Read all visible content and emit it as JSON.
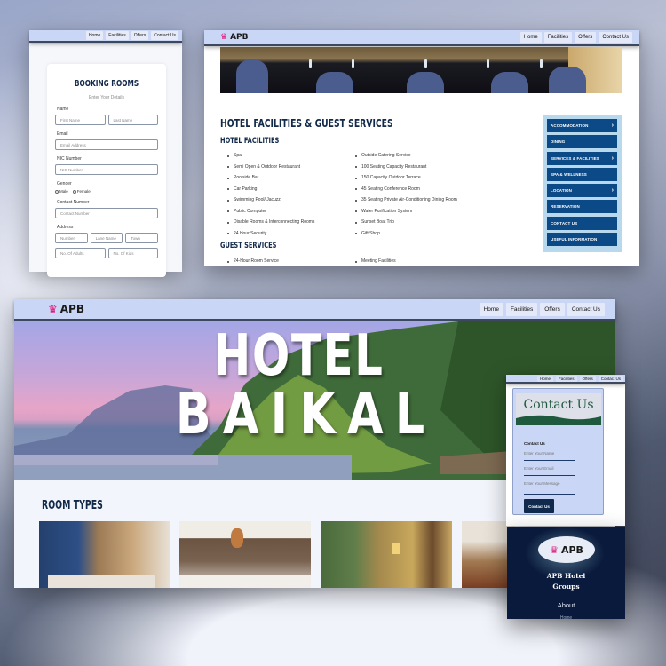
{
  "nav": {
    "items": [
      "Home",
      "Facilities",
      "Offers",
      "Contact Us"
    ]
  },
  "brand": {
    "logo_text": "APB",
    "logo_icon": "lotus-icon",
    "accent_color": "#e0187a",
    "navy_color": "#12294a"
  },
  "booking": {
    "title": "BOOKING ROOMS",
    "subtitle": "Enter Your Details",
    "name_label": "Name",
    "first_name_placeholder": "First Name",
    "last_name_placeholder": "Last Name",
    "email_label": "Email",
    "email_placeholder": "Email Address",
    "nic_label": "NIC Number",
    "nic_placeholder": "NIC Number",
    "gender_label": "Gender",
    "gender_options": [
      "Male",
      "Female"
    ],
    "contact_label": "Contact Number",
    "contact_placeholder": "Contact Number",
    "address_label": "Address",
    "address_placeholders": [
      "Number",
      "Lane Name",
      "Town"
    ],
    "adults_placeholder": "No. Of Adults",
    "kids_placeholder": "No. Of Kids"
  },
  "facilities": {
    "title": "HOTEL FACILITIES & GUEST SERVICES",
    "hotel_facilities_heading": "HOTEL FACILITIES",
    "hotel_facilities_left": [
      "Spa",
      "Semi Open & Outdoor Restaurant",
      "Poolside Bar",
      "Car Parking",
      "Swimming Pool/ Jacuzzi",
      "Public Computer",
      "Disable Rooms & Interconnecting Rooms",
      "24 Hour Security"
    ],
    "hotel_facilities_right": [
      "Outside Catering Service",
      "100 Seating Capacity Restaurant",
      "150 Capacity Outdoor Terrace",
      "45 Seating Conference Room",
      "35 Seating Private Air-Conditioning Dining Room",
      "Water Purification System",
      "Sunset Boat Trip",
      "Gift Shop"
    ],
    "guest_services_heading": "GUEST SERVICES",
    "guest_services_left": [
      "24-Hour Room Service"
    ],
    "guest_services_right": [
      "Meeting Facilities"
    ],
    "side_menu": [
      {
        "label": "ACCOMMODATION",
        "has_arrow": true
      },
      {
        "label": "DINING",
        "has_arrow": false
      },
      {
        "label": "SERVICES & FACILITIES",
        "has_arrow": true
      },
      {
        "label": "SPA & WELLNESS",
        "has_arrow": false
      },
      {
        "label": "LOCATION",
        "has_arrow": true
      },
      {
        "label": "RESERVATION",
        "has_arrow": false
      },
      {
        "label": "CONTACT US",
        "has_arrow": false
      },
      {
        "label": "USEFUL INFORMATION",
        "has_arrow": false
      }
    ],
    "arrow_glyph": "›"
  },
  "home": {
    "hero_line1": "HOTEL",
    "hero_line2": "BAIKAL",
    "room_types_heading": "ROOM TYPES",
    "room_images": [
      "room-image-1",
      "room-image-2",
      "room-image-3",
      "room-image-4"
    ]
  },
  "contact": {
    "banner_title": "Contact Us",
    "form_label": "Contact Us",
    "name_placeholder": "Enter Your Name",
    "email_placeholder": "Enter Your Email",
    "message_placeholder": "Enter Your Message",
    "submit_label": "Contact Us"
  },
  "footer": {
    "company_line1": "APB Hotel",
    "company_line2": "Groups",
    "about_label": "About",
    "home_label": "Home"
  }
}
